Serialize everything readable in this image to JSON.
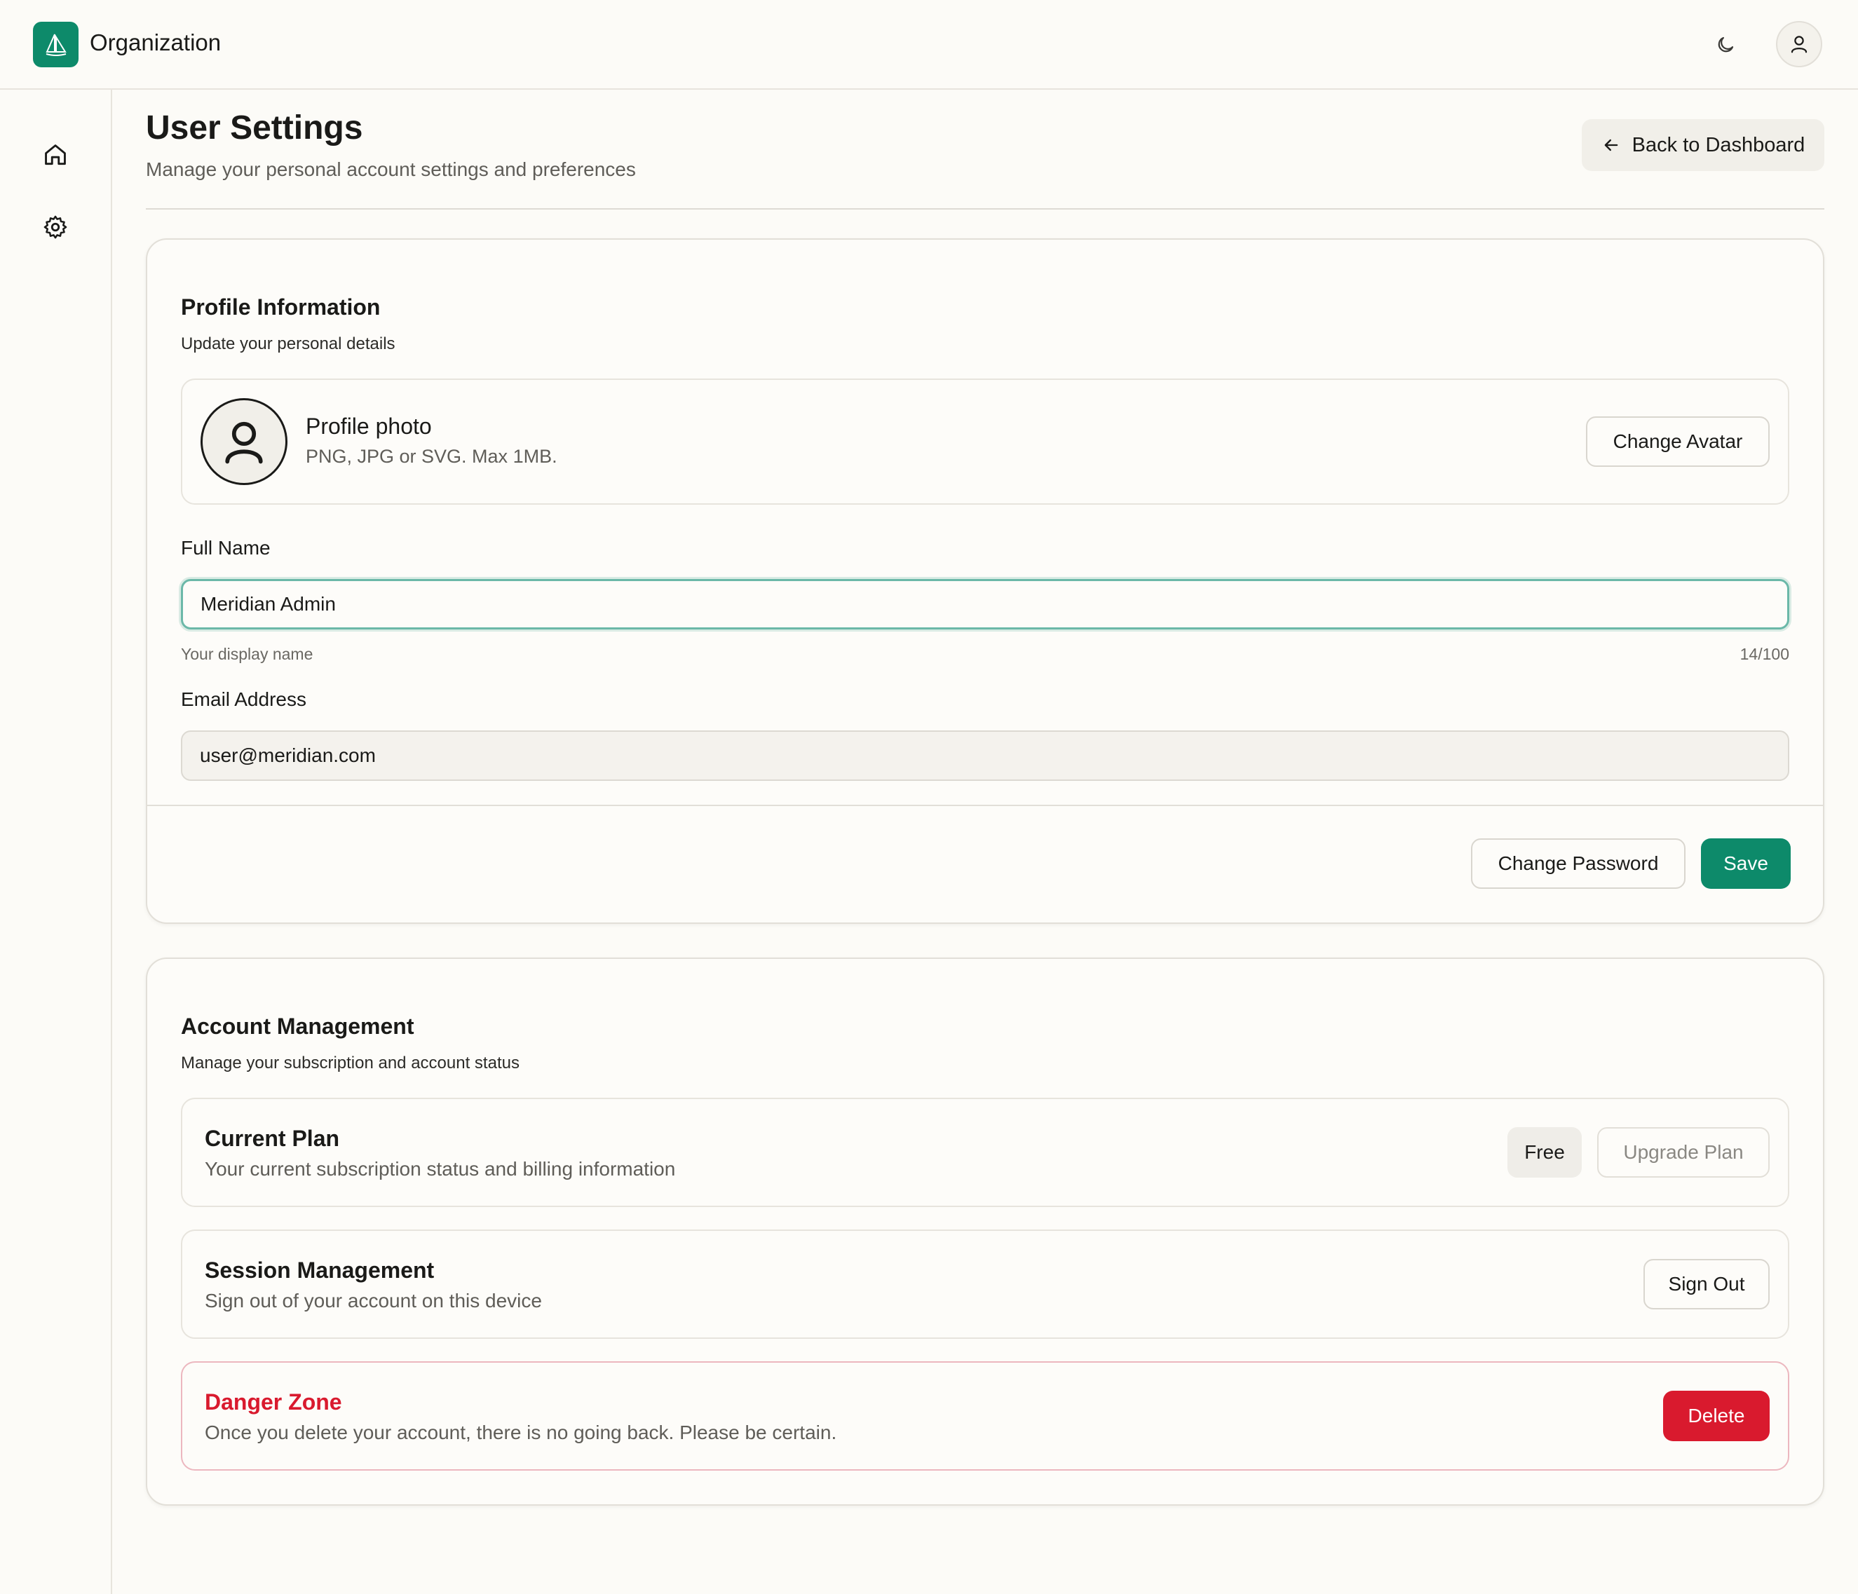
{
  "header": {
    "org_name": "Organization",
    "logo_icon": "sailboat-icon",
    "theme_icon": "moon-icon",
    "user_icon": "user-icon"
  },
  "sidebar": {
    "items": [
      {
        "icon": "home-icon"
      },
      {
        "icon": "gear-icon"
      }
    ]
  },
  "page": {
    "title": "User Settings",
    "subtitle": "Manage your personal account settings and preferences",
    "back_label": "Back to Dashboard"
  },
  "profile": {
    "title": "Profile Information",
    "description": "Update your personal details",
    "photo_title": "Profile photo",
    "photo_hint": "PNG, JPG or SVG. Max 1MB.",
    "change_avatar_label": "Change Avatar",
    "full_name_label": "Full Name",
    "full_name_value": "Meridian Admin",
    "full_name_help": "Your display name",
    "full_name_count": "14/100",
    "email_label": "Email Address",
    "email_value": "user@meridian.com",
    "change_password_label": "Change Password",
    "save_label": "Save"
  },
  "account": {
    "title": "Account Management",
    "description": "Manage your subscription and account status",
    "plan_title": "Current Plan",
    "plan_desc": "Your current subscription status and billing information",
    "plan_badge": "Free",
    "upgrade_label": "Upgrade Plan",
    "session_title": "Session Management",
    "session_desc": "Sign out of your account on this device",
    "sign_out_label": "Sign Out",
    "danger_title": "Danger Zone",
    "danger_desc": "Once you delete your account, there is no going back. Please be certain.",
    "delete_label": "Delete"
  },
  "colors": {
    "brand": "#0d8a6a",
    "danger": "#d91a2e",
    "background": "#fcfbf7"
  }
}
